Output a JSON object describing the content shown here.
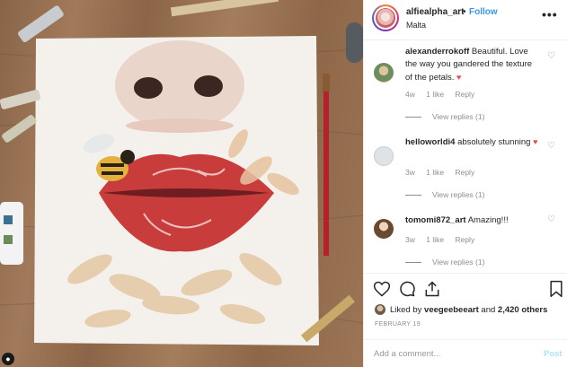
{
  "post": {
    "username": "alfiealpha_art",
    "separator": "•",
    "follow_label": "Follow",
    "location": "Malta",
    "more_label": "•••"
  },
  "comments": [
    {
      "username": "alexanderrokoff",
      "text": "Beautiful. Love the way you gandered the texture of the petals.",
      "emoji": "♥",
      "age": "4w",
      "likes": "1 like",
      "reply_label": "Reply",
      "view_replies": "View replies (1)"
    },
    {
      "username": "helloworldi4",
      "text": "absolutely stunning",
      "emoji": "♥",
      "age": "3w",
      "likes": "1 like",
      "reply_label": "Reply",
      "view_replies": "View replies (1)"
    },
    {
      "username": "tomomi872_art",
      "text": "Amazing!!!",
      "emoji": "",
      "age": "3w",
      "likes": "1 like",
      "reply_label": "Reply",
      "view_replies": "View replies (1)"
    }
  ],
  "actions": {
    "liked_by_prefix": "Liked by",
    "liked_by_user": "veegeebeeart",
    "liked_by_and": "and",
    "liked_by_count": "2,420 others",
    "date": "FEBRUARY 19"
  },
  "add_comment": {
    "placeholder": "Add a comment...",
    "post_label": "Post"
  },
  "icons": [
    "heart-icon",
    "comment-icon",
    "share-icon",
    "bookmark-icon",
    "more-icon"
  ],
  "colors": {
    "link_blue": "#3897f0",
    "heart_red": "#ed4956",
    "post_disabled": "#b2dffc",
    "meta_gray": "#8e8e8e"
  }
}
